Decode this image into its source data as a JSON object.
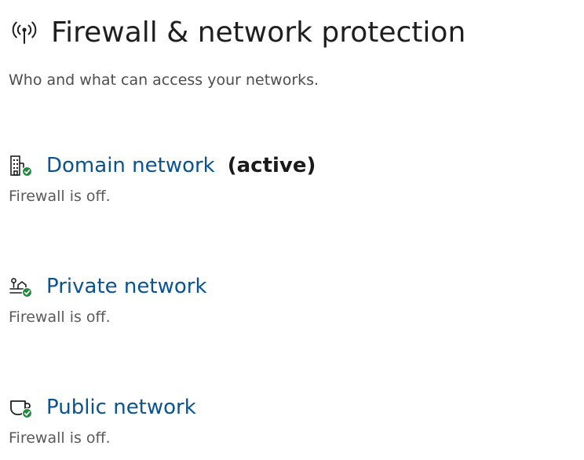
{
  "page": {
    "title": "Firewall & network protection",
    "subtitle": "Who and what can access your networks.",
    "icon": "antenna-icon"
  },
  "networks": [
    {
      "label": "Domain network",
      "active_label": "(active)",
      "status": "Firewall is off.",
      "icon": "domain-building-icon",
      "badge": "green-check-icon"
    },
    {
      "label": "Private network",
      "status": "Firewall is off.",
      "icon": "private-home-icon",
      "badge": "green-check-icon"
    },
    {
      "label": "Public network",
      "status": "Firewall is off.",
      "icon": "public-cafe-icon",
      "badge": "green-check-icon"
    }
  ],
  "colors": {
    "link": "#0a5392",
    "badge_green": "#1e8a3c",
    "title_text": "#1f1f1f",
    "body_text": "#4d4d4d"
  }
}
